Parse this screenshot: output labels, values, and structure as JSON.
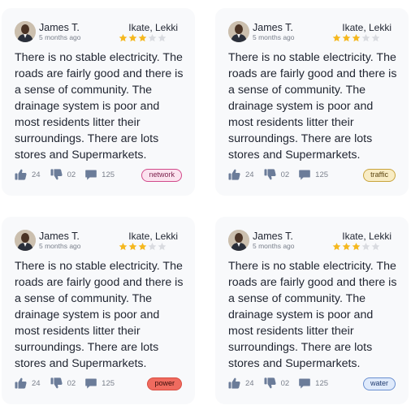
{
  "reviews": [
    {
      "name": "James T.",
      "date": "5 months ago",
      "location": "Ikate, Lekki",
      "rating": 3,
      "max_rating": 5,
      "text": "There is no stable electricity. The roads are fairly good and there is a sense of community. The drainage system is poor and most residents litter their surroundings. There are lots stores and Supermarkets.",
      "likes": "24",
      "dislikes": "02",
      "comments": "125",
      "tag": "network",
      "tag_bg": "#fbe3ef",
      "tag_border": "#d24a8b",
      "tag_color": "#7a1f4b"
    },
    {
      "name": "James T.",
      "date": "5 months ago",
      "location": "Ikate, Lekki",
      "rating": 3,
      "max_rating": 5,
      "text": "There is no stable electricity. The roads are fairly good and there is a sense of community. The drainage system is poor and most residents litter their surroundings. There are lots stores and Supermarkets.",
      "likes": "24",
      "dislikes": "02",
      "comments": "125",
      "tag": "traffic",
      "tag_bg": "#f8ecc4",
      "tag_border": "#c9a43c",
      "tag_color": "#5a4410"
    },
    {
      "name": "James T.",
      "date": "5 months ago",
      "location": "Ikate, Lekki",
      "rating": 3,
      "max_rating": 5,
      "text": "There is no stable electricity. The roads are fairly good and there is a sense of community. The drainage system is poor and most residents litter their surroundings. There are lots stores and Supermarkets.",
      "likes": "24",
      "dislikes": "02",
      "comments": "125",
      "tag": "power",
      "tag_bg": "#ef6b5f",
      "tag_border": "#d94c40",
      "tag_color": "#3a0d09"
    },
    {
      "name": "James T.",
      "date": "5 months ago",
      "location": "Ikate, Lekki",
      "rating": 3,
      "max_rating": 5,
      "text": "There is no stable electricity. The roads are fairly good and there is a sense of community. The drainage system is poor and most residents litter their surroundings. There are lots stores and Supermarkets.",
      "likes": "24",
      "dislikes": "02",
      "comments": "125",
      "tag": "water",
      "tag_bg": "#dfeafb",
      "tag_border": "#6a8fd0",
      "tag_color": "#1f3a6e"
    }
  ],
  "colors": {
    "star_filled": "#f5b81f",
    "star_empty": "#d9dbe0",
    "icon": "#6b7c99"
  },
  "icons": {
    "like": "thumbs-up-icon",
    "dislike": "thumbs-down-icon",
    "comment": "comment-icon",
    "star": "star-icon"
  }
}
